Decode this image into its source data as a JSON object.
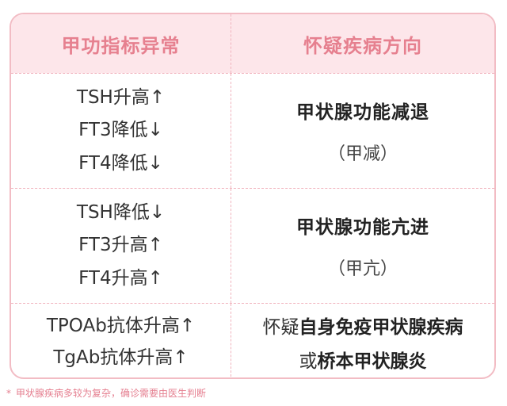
{
  "table": {
    "header": {
      "left": "甲功指标异常",
      "right": "怀疑疾病方向"
    },
    "groups": [
      {
        "indicators": [
          "TSH升高↑",
          "FT3降低↓",
          "FT4降低↓"
        ],
        "diagnosis": "甲状腺功能减退",
        "abbr": "（甲减）"
      },
      {
        "indicators": [
          "TSH降低↓",
          "FT3升高↑",
          "FT4升高↑"
        ],
        "diagnosis": "甲状腺功能亢进",
        "abbr": "（甲亢）"
      },
      {
        "indicators": [
          "TPOAb抗体升高↑",
          "TgAb抗体升高↑"
        ],
        "line1": {
          "prefix": "怀疑",
          "bold": "自身免疫甲状腺疾病"
        },
        "line2": {
          "prefix": "或",
          "bold": "桥本甲状腺炎"
        }
      }
    ]
  },
  "footnote": {
    "star": "*",
    "text": "甲状腺疾病多较为复杂，确诊需要由医生判断"
  },
  "colors": {
    "header_bg": "#fde6ea",
    "header_text": "#e6808f",
    "border": "#f2bcc4",
    "footnote": "#e57f90"
  }
}
